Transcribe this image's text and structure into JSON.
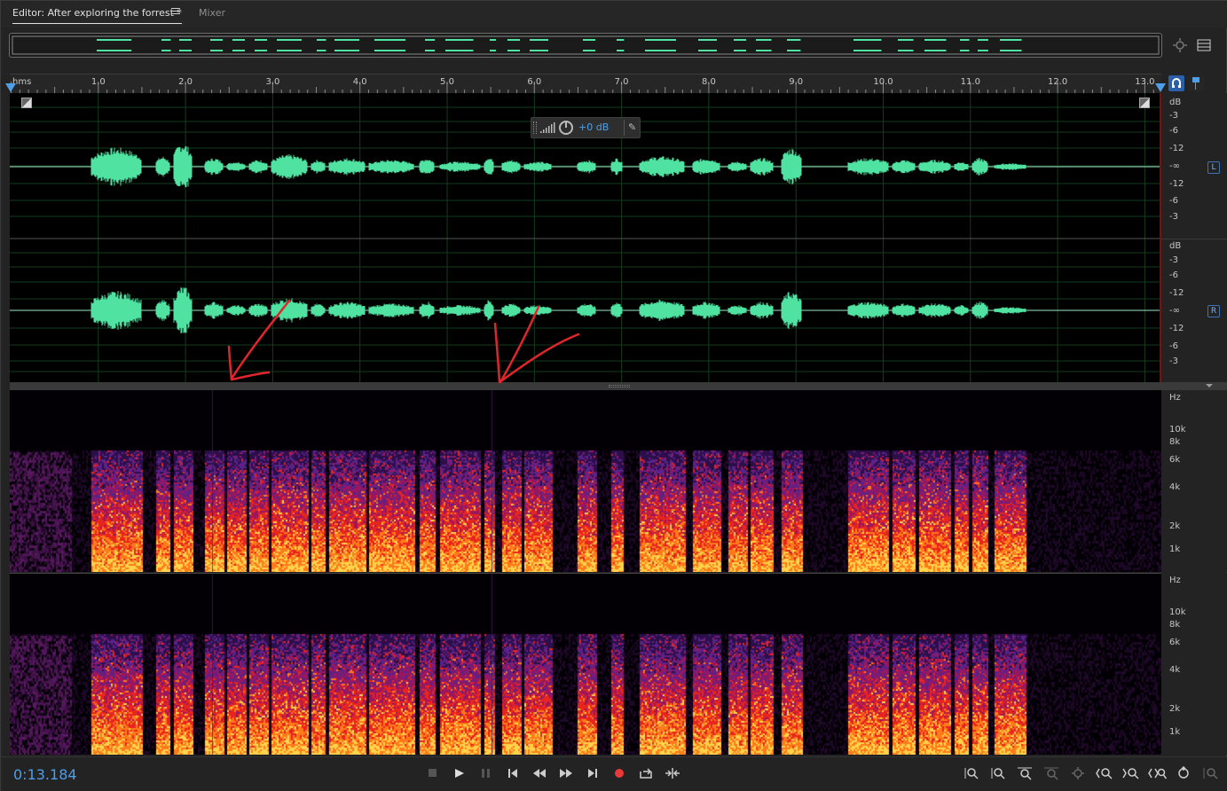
{
  "tabs": {
    "editor_label": "Editor: After exploring the forrest *",
    "mixer_label": "Mixer"
  },
  "ruler": {
    "unit": "hms",
    "ticks": [
      "1.0",
      "2.0",
      "3.0",
      "4.0",
      "5.0",
      "6.0",
      "7.0",
      "8.0",
      "9.0",
      "10.0",
      "11.0",
      "12.0",
      "13.0"
    ]
  },
  "hud": {
    "gain": "+0 dB"
  },
  "channels": [
    {
      "badge": "L",
      "db_labels": [
        "dB",
        "-3",
        "-6",
        "-12",
        "-∞",
        "-12",
        "-6",
        "-3"
      ]
    },
    {
      "badge": "R",
      "db_labels": [
        "dB",
        "-3",
        "-6",
        "-12",
        "-∞",
        "-12",
        "-6",
        "-3"
      ]
    }
  ],
  "spectral": [
    {
      "hz_labels": [
        "Hz",
        "10k",
        "8k",
        "6k",
        "4k",
        "2k",
        "1k"
      ]
    },
    {
      "hz_labels": [
        "Hz",
        "10k",
        "8k",
        "6k",
        "4k",
        "2k",
        "1k"
      ]
    }
  ],
  "colors": {
    "waveform": "#4fe2a0",
    "accent": "#4f9fe8",
    "annotation": "#e0262b",
    "record": "#e83a3a"
  },
  "transport": {
    "current_time": "0:13.184"
  }
}
